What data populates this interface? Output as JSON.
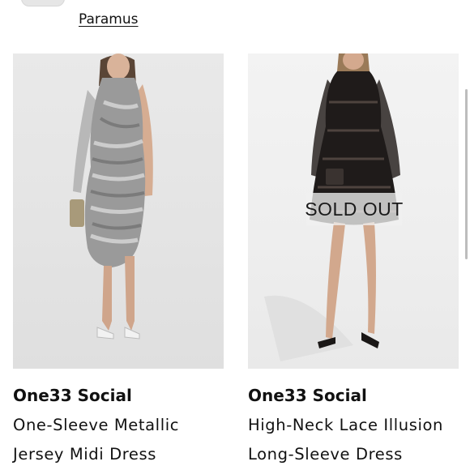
{
  "store": {
    "link_label": "Paramus"
  },
  "products": [
    {
      "brand": "One33 Social",
      "title_line1": "One-Sleeve Metallic",
      "title_line2": "Jersey Midi Dress",
      "image_icon": "silver-dress-photo",
      "sold_out": false
    },
    {
      "brand": "One33 Social",
      "title_line1": "High-Neck Lace Illusion",
      "title_line2": "Long-Sleeve Dress",
      "image_icon": "black-lace-dress-photo",
      "sold_out": true,
      "sold_out_label": "SOLD OUT"
    }
  ],
  "colors": {
    "text": "#111111",
    "image_bg": "#e6e6e6",
    "overlay": "#f0f0f0"
  }
}
